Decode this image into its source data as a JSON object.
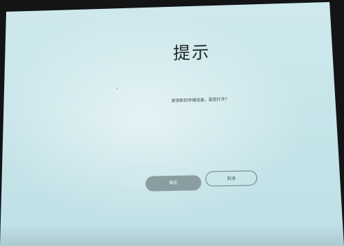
{
  "dialog": {
    "title": "提示",
    "message": "发现新的存储设备，是否打开?",
    "confirm_label": "确定",
    "cancel_label": "取消"
  },
  "colors": {
    "screen_background": "#c8e6ea",
    "title_text": "#1e2628",
    "confirm_button_fill": "#8a9ea2",
    "cancel_button_border": "#6b7b7e",
    "frame": "#121416"
  }
}
